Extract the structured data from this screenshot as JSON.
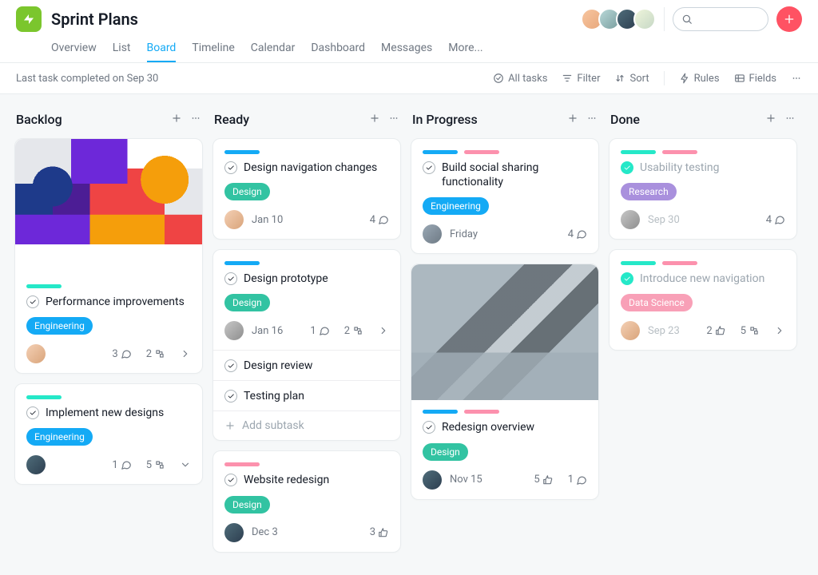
{
  "project": {
    "title": "Sprint Plans"
  },
  "tabs": [
    "Overview",
    "List",
    "Board",
    "Timeline",
    "Calendar",
    "Dashboard",
    "Messages",
    "More..."
  ],
  "activeTab": "Board",
  "toolbar": {
    "status": "Last task completed on Sep 30",
    "allTasks": "All tasks",
    "filter": "Filter",
    "sort": "Sort",
    "rules": "Rules",
    "fields": "Fields"
  },
  "columns": {
    "backlog": {
      "title": "Backlog"
    },
    "ready": {
      "title": "Ready"
    },
    "inprogress": {
      "title": "In Progress"
    },
    "done": {
      "title": "Done"
    }
  },
  "cards": {
    "perf": {
      "title": "Performance improvements",
      "tag": "Engineering",
      "comments": "3",
      "subtasks": "2"
    },
    "impl": {
      "title": "Implement new designs",
      "tag": "Engineering",
      "comments": "1",
      "subtasks": "5"
    },
    "nav": {
      "title": "Design navigation changes",
      "tag": "Design",
      "date": "Jan 10",
      "comments": "4"
    },
    "proto": {
      "title": "Design prototype",
      "tag": "Design",
      "date": "Jan 16",
      "comments": "1",
      "subtasks": "2",
      "sub1": "Design review",
      "sub2": "Testing plan",
      "addSub": "Add subtask"
    },
    "web": {
      "title": "Website redesign",
      "tag": "Design",
      "date": "Dec 3",
      "likes": "3"
    },
    "social": {
      "title": "Build social sharing functionality",
      "tag": "Engineering",
      "date": "Friday",
      "comments": "4"
    },
    "redesign": {
      "title": "Redesign overview",
      "tag": "Design",
      "date": "Nov 15",
      "likes": "5",
      "comments": "1"
    },
    "usability": {
      "title": "Usability testing",
      "tag": "Research",
      "date": "Sep 30",
      "comments": "4"
    },
    "intro": {
      "title": "Introduce new navigation",
      "tag": "Data Science",
      "date": "Sep 23",
      "likes": "2",
      "subtasks": "5"
    }
  }
}
